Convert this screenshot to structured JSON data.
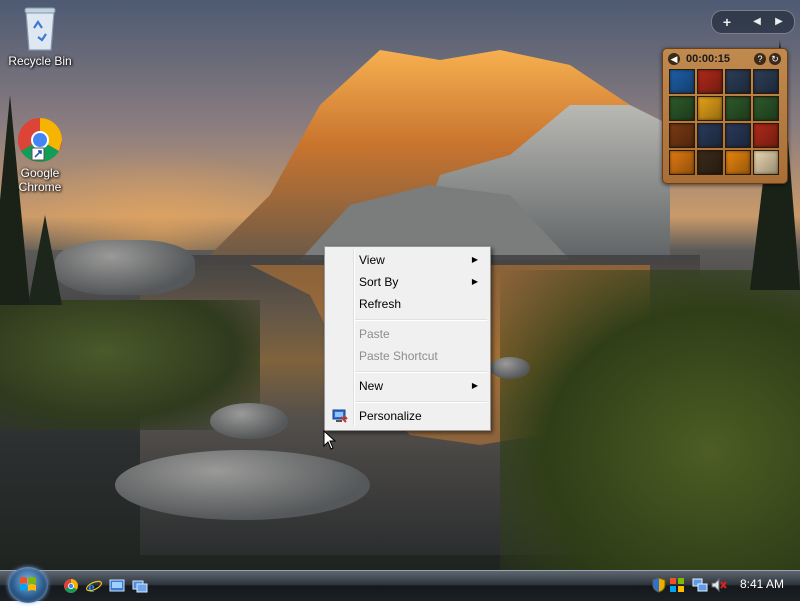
{
  "desktop": {
    "icons": [
      {
        "label": "Recycle Bin",
        "icon": "recycle-bin-icon"
      },
      {
        "label": "Google Chrome",
        "icon": "chrome-icon"
      }
    ]
  },
  "gadget": {
    "timer": "00:00:15",
    "tile_colors": [
      "#1d5fa8",
      "#b02a1a",
      "#2c3e58",
      "#2c3e58",
      "#2d5a2a",
      "#e6a21a",
      "#2d5a2a",
      "#2d5a2a",
      "#7a3a14",
      "#2a3a5a",
      "#2a3a5a",
      "#b02a1a",
      "#e07a12",
      "#3b2a1a",
      "#e8860e",
      "#e9d6b0"
    ]
  },
  "context_menu": {
    "items": [
      {
        "label": "View",
        "submenu": true,
        "enabled": true
      },
      {
        "label": "Sort By",
        "submenu": true,
        "enabled": true
      },
      {
        "label": "Refresh",
        "submenu": false,
        "enabled": true
      },
      {
        "label": "Paste",
        "submenu": false,
        "enabled": false
      },
      {
        "label": "Paste Shortcut",
        "submenu": false,
        "enabled": false
      },
      {
        "label": "New",
        "submenu": true,
        "enabled": true
      },
      {
        "label": "Personalize",
        "submenu": false,
        "enabled": true,
        "icon": "personalize-icon"
      }
    ]
  },
  "taskbar": {
    "quick_launch": [
      "chrome-icon",
      "internet-explorer-icon",
      "show-desktop-icon",
      "switch-windows-icon"
    ],
    "tray_icons": [
      "security-shield-icon",
      "network-icon",
      "volume-muted-icon"
    ],
    "clock": "8:41 AM"
  }
}
